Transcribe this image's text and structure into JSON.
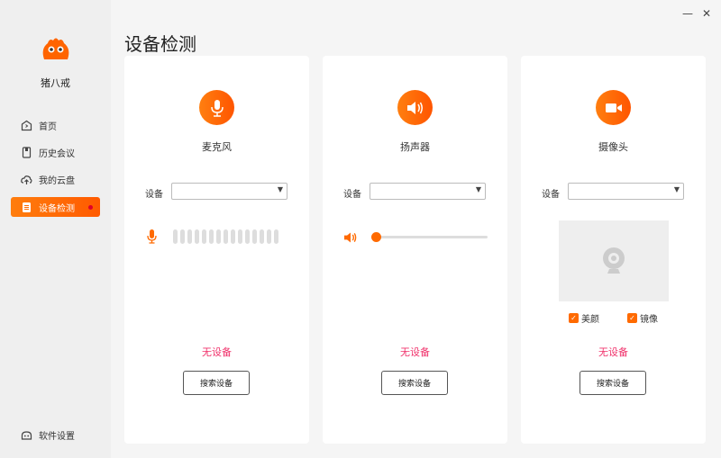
{
  "app": {
    "name": "猪八戒",
    "title": "设备检测",
    "minimize": "—",
    "close": "✕"
  },
  "sidebar": {
    "items": [
      {
        "label": "首页",
        "icon": "home-icon"
      },
      {
        "label": "历史会议",
        "icon": "history-icon"
      },
      {
        "label": "我的云盘",
        "icon": "cloud-upload-icon"
      },
      {
        "label": "设备检测",
        "icon": "device-check-icon",
        "active": true
      }
    ],
    "settings": "软件设置"
  },
  "colors": {
    "accent": "#ff6a00",
    "error": "#f0306a"
  },
  "cards": [
    {
      "name": "麦克风",
      "device_label": "设备",
      "device_value": "",
      "status": "无设备",
      "button": "搜索设备",
      "level_bars": 15,
      "level": 0
    },
    {
      "name": "扬声器",
      "device_label": "设备",
      "device_value": "",
      "status": "无设备",
      "button": "搜索设备",
      "volume": 0
    },
    {
      "name": "摄像头",
      "device_label": "设备",
      "device_value": "",
      "status": "无设备",
      "button": "搜索设备",
      "beauty": "美颜",
      "beauty_checked": true,
      "mirror": "镜像",
      "mirror_checked": true
    }
  ]
}
